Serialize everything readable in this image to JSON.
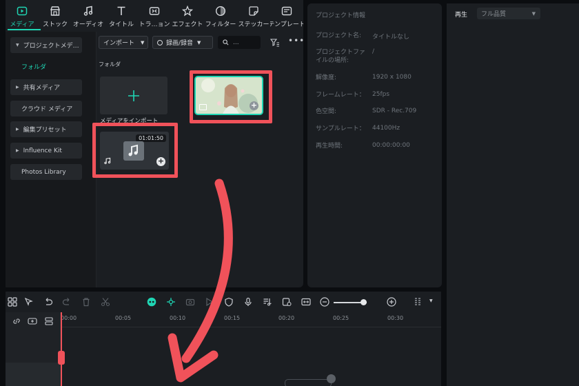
{
  "tool_tabs": [
    {
      "label": "メディア",
      "icon": "media-icon",
      "active": true
    },
    {
      "label": "ストック",
      "icon": "stock-icon"
    },
    {
      "label": "オーディオ",
      "icon": "music-note-icon"
    },
    {
      "label": "タイトル",
      "icon": "title-t-icon"
    },
    {
      "label": "トラ…ョン",
      "icon": "transition-icon"
    },
    {
      "label": "エフェクト",
      "icon": "effect-star-icon"
    },
    {
      "label": "フィルター",
      "icon": "filter-icon"
    },
    {
      "label": "ステッカー",
      "icon": "sticker-icon"
    },
    {
      "label": "テンプレート",
      "icon": "template-icon"
    }
  ],
  "sidebar": {
    "items": [
      {
        "label": "プロジェクトメデ…",
        "expanded": true
      },
      {
        "label": "共有メディア",
        "expanded": false
      },
      {
        "label": "クラウド メディア"
      },
      {
        "label": "編集プリセット",
        "expanded": false
      },
      {
        "label": "Influence Kit",
        "expanded": false
      },
      {
        "label": "Photos Library"
      }
    ],
    "sub_item": "フォルダ"
  },
  "media_toolbar": {
    "import_label": "インポート",
    "record_label": "録画/録音",
    "search_placeholder": "..."
  },
  "folder_label": "フォルダ",
  "import_tile_label": "メディアをインポート",
  "audio_clip": {
    "duration": "01:01:50"
  },
  "project_info": {
    "title": "プロジェクト情報",
    "rows": [
      {
        "label": "プロジェクト名:",
        "value": "タイトルなし"
      },
      {
        "label": "プロジェクトファイルの場所:",
        "value": "/"
      },
      {
        "label": "解像度:",
        "value": "1920 x 1080"
      },
      {
        "label": "フレームレート：",
        "value": "25fps"
      },
      {
        "label": "色空間:",
        "value": "SDR - Rec.709"
      },
      {
        "label": "サンプルレート：",
        "value": "44100Hz"
      },
      {
        "label": "再生時間:",
        "value": "00:00:00:00"
      }
    ]
  },
  "player": {
    "label": "再生",
    "quality": "フル品質"
  },
  "timeline": {
    "ticks": [
      "00:00",
      "00:05",
      "00:10",
      "00:15",
      "00:20",
      "00:25",
      "00:30"
    ]
  },
  "colors": {
    "accent": "#1fd6b4",
    "highlight": "#f0525a"
  }
}
